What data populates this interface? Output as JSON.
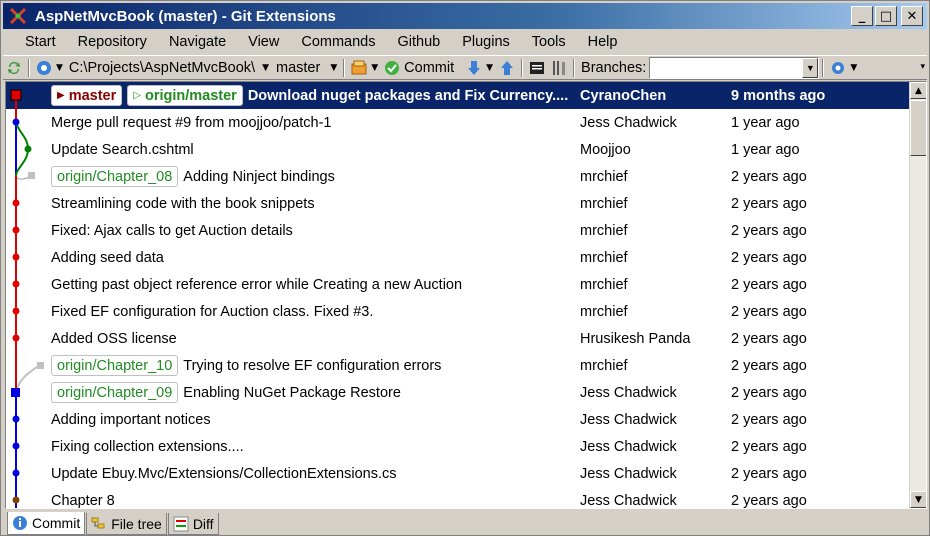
{
  "window": {
    "title": "AspNetMvcBook (master) - Git Extensions"
  },
  "menu": [
    "Start",
    "Repository",
    "Navigate",
    "View",
    "Commands",
    "Github",
    "Plugins",
    "Tools",
    "Help"
  ],
  "toolbar": {
    "path": "C:\\Projects\\AspNetMvcBook\\",
    "branch": "master",
    "commit_label": "Commit",
    "branches_label": "Branches:",
    "branches_value": ""
  },
  "commits": [
    {
      "refs": [
        {
          "name": "master",
          "kind": "local"
        },
        {
          "name": "origin/master",
          "kind": "remote"
        }
      ],
      "message": "Download nuget packages and Fix Currency....",
      "author": "CyranoChen",
      "date": "9 months ago",
      "selected": true
    },
    {
      "refs": [],
      "message": "Merge pull request #9 from moojjoo/patch-1",
      "author": "Jess Chadwick",
      "date": "1 year ago"
    },
    {
      "refs": [],
      "message": "Update Search.cshtml",
      "author": "Moojjoo",
      "date": "1 year ago"
    },
    {
      "refs": [
        {
          "name": "origin/Chapter_08",
          "kind": "remote"
        }
      ],
      "message": "Adding Ninject bindings",
      "author": "mrchief",
      "date": "2 years ago"
    },
    {
      "refs": [],
      "message": "Streamlining code with the book snippets",
      "author": "mrchief",
      "date": "2 years ago"
    },
    {
      "refs": [],
      "message": "Fixed: Ajax calls to get Auction details",
      "author": "mrchief",
      "date": "2 years ago"
    },
    {
      "refs": [],
      "message": "Adding seed data",
      "author": "mrchief",
      "date": "2 years ago"
    },
    {
      "refs": [],
      "message": "Getting past object reference error while Creating a new Auction",
      "author": "mrchief",
      "date": "2 years ago"
    },
    {
      "refs": [],
      "message": "Fixed EF configuration for Auction class. Fixed #3.",
      "author": "mrchief",
      "date": "2 years ago"
    },
    {
      "refs": [],
      "message": "Added OSS license",
      "author": "Hrusikesh Panda",
      "date": "2 years ago"
    },
    {
      "refs": [
        {
          "name": "origin/Chapter_10",
          "kind": "remote"
        }
      ],
      "message": "Trying to resolve EF configuration errors",
      "author": "mrchief",
      "date": "2 years ago"
    },
    {
      "refs": [
        {
          "name": "origin/Chapter_09",
          "kind": "remote"
        }
      ],
      "message": "Enabling NuGet Package Restore",
      "author": "Jess Chadwick",
      "date": "2 years ago"
    },
    {
      "refs": [],
      "message": "Adding important notices",
      "author": "Jess Chadwick",
      "date": "2 years ago"
    },
    {
      "refs": [],
      "message": "Fixing collection extensions....",
      "author": "Jess Chadwick",
      "date": "2 years ago"
    },
    {
      "refs": [],
      "message": "Update Ebuy.Mvc/Extensions/CollectionExtensions.cs",
      "author": "Jess Chadwick",
      "date": "2 years ago"
    },
    {
      "refs": [],
      "message": "Chapter 8",
      "author": "Jess Chadwick",
      "date": "2 years ago"
    }
  ],
  "tabs": [
    {
      "label": "Commit",
      "icon": "info-icon",
      "active": true
    },
    {
      "label": "File tree",
      "icon": "file-tree-icon",
      "active": false
    },
    {
      "label": "Diff",
      "icon": "diff-icon",
      "active": false
    }
  ],
  "colors": {
    "selection": "#0a246a",
    "remote_ref": "#228b22",
    "local_ref": "#8b0000",
    "graph_red": "#e00000",
    "graph_blue": "#0000e0",
    "graph_green": "#008000"
  }
}
